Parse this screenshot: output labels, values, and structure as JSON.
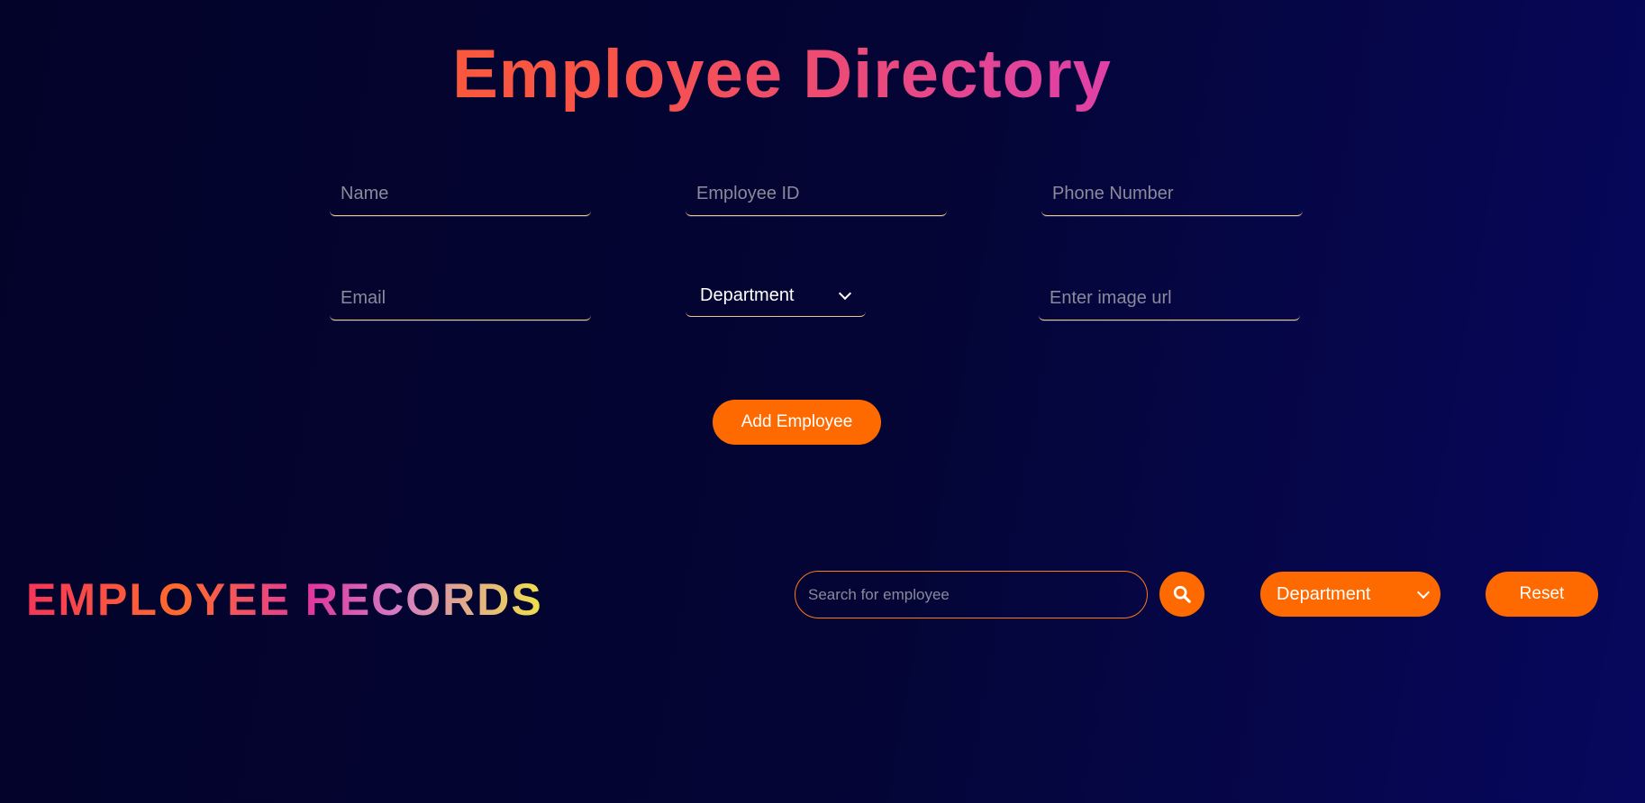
{
  "header": {
    "title": "Employee Directory"
  },
  "form": {
    "name_placeholder": "Name",
    "employee_id_placeholder": "Employee ID",
    "phone_placeholder": "Phone Number",
    "email_placeholder": "Email",
    "department_selected": "Department",
    "image_url_placeholder": "Enter image url",
    "submit_label": "Add Employee"
  },
  "records": {
    "title": "EMPLOYEE RECORDS",
    "search_placeholder": "Search for employee",
    "search_icon": "search-icon",
    "filter_selected": "Department",
    "reset_label": "Reset"
  },
  "colors": {
    "background": "#03032a",
    "accent": "#ff6a00",
    "underline": "#e8c98a"
  }
}
